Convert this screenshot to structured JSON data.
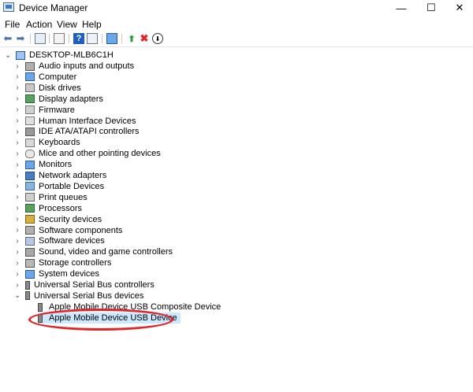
{
  "window": {
    "title": "Device Manager",
    "minimize": "—",
    "maximize": "☐",
    "close": "✕"
  },
  "menu": [
    "File",
    "Action",
    "View",
    "Help"
  ],
  "toolbar": {
    "back_icon": "back-arrow-icon",
    "forward_icon": "forward-arrow-icon",
    "colors": {
      "remove": "#e0252b",
      "help": "#1f5fbf",
      "green": "#2e9b3a"
    }
  },
  "tree": {
    "root": "DESKTOP-MLB6C1H",
    "categories": [
      "Audio inputs and outputs",
      "Computer",
      "Disk drives",
      "Display adapters",
      "Firmware",
      "Human Interface Devices",
      "IDE ATA/ATAPI controllers",
      "Keyboards",
      "Mice and other pointing devices",
      "Monitors",
      "Network adapters",
      "Portable Devices",
      "Print queues",
      "Processors",
      "Security devices",
      "Software components",
      "Software devices",
      "Sound, video and game controllers",
      "Storage controllers",
      "System devices",
      "Universal Serial Bus controllers",
      "Universal Serial Bus devices"
    ],
    "usb_children": [
      "Apple Mobile Device USB Composite Device",
      "Apple Mobile Device USB Device"
    ]
  },
  "highlight_color": "#e0252b",
  "selection_color": "#cce8ff"
}
